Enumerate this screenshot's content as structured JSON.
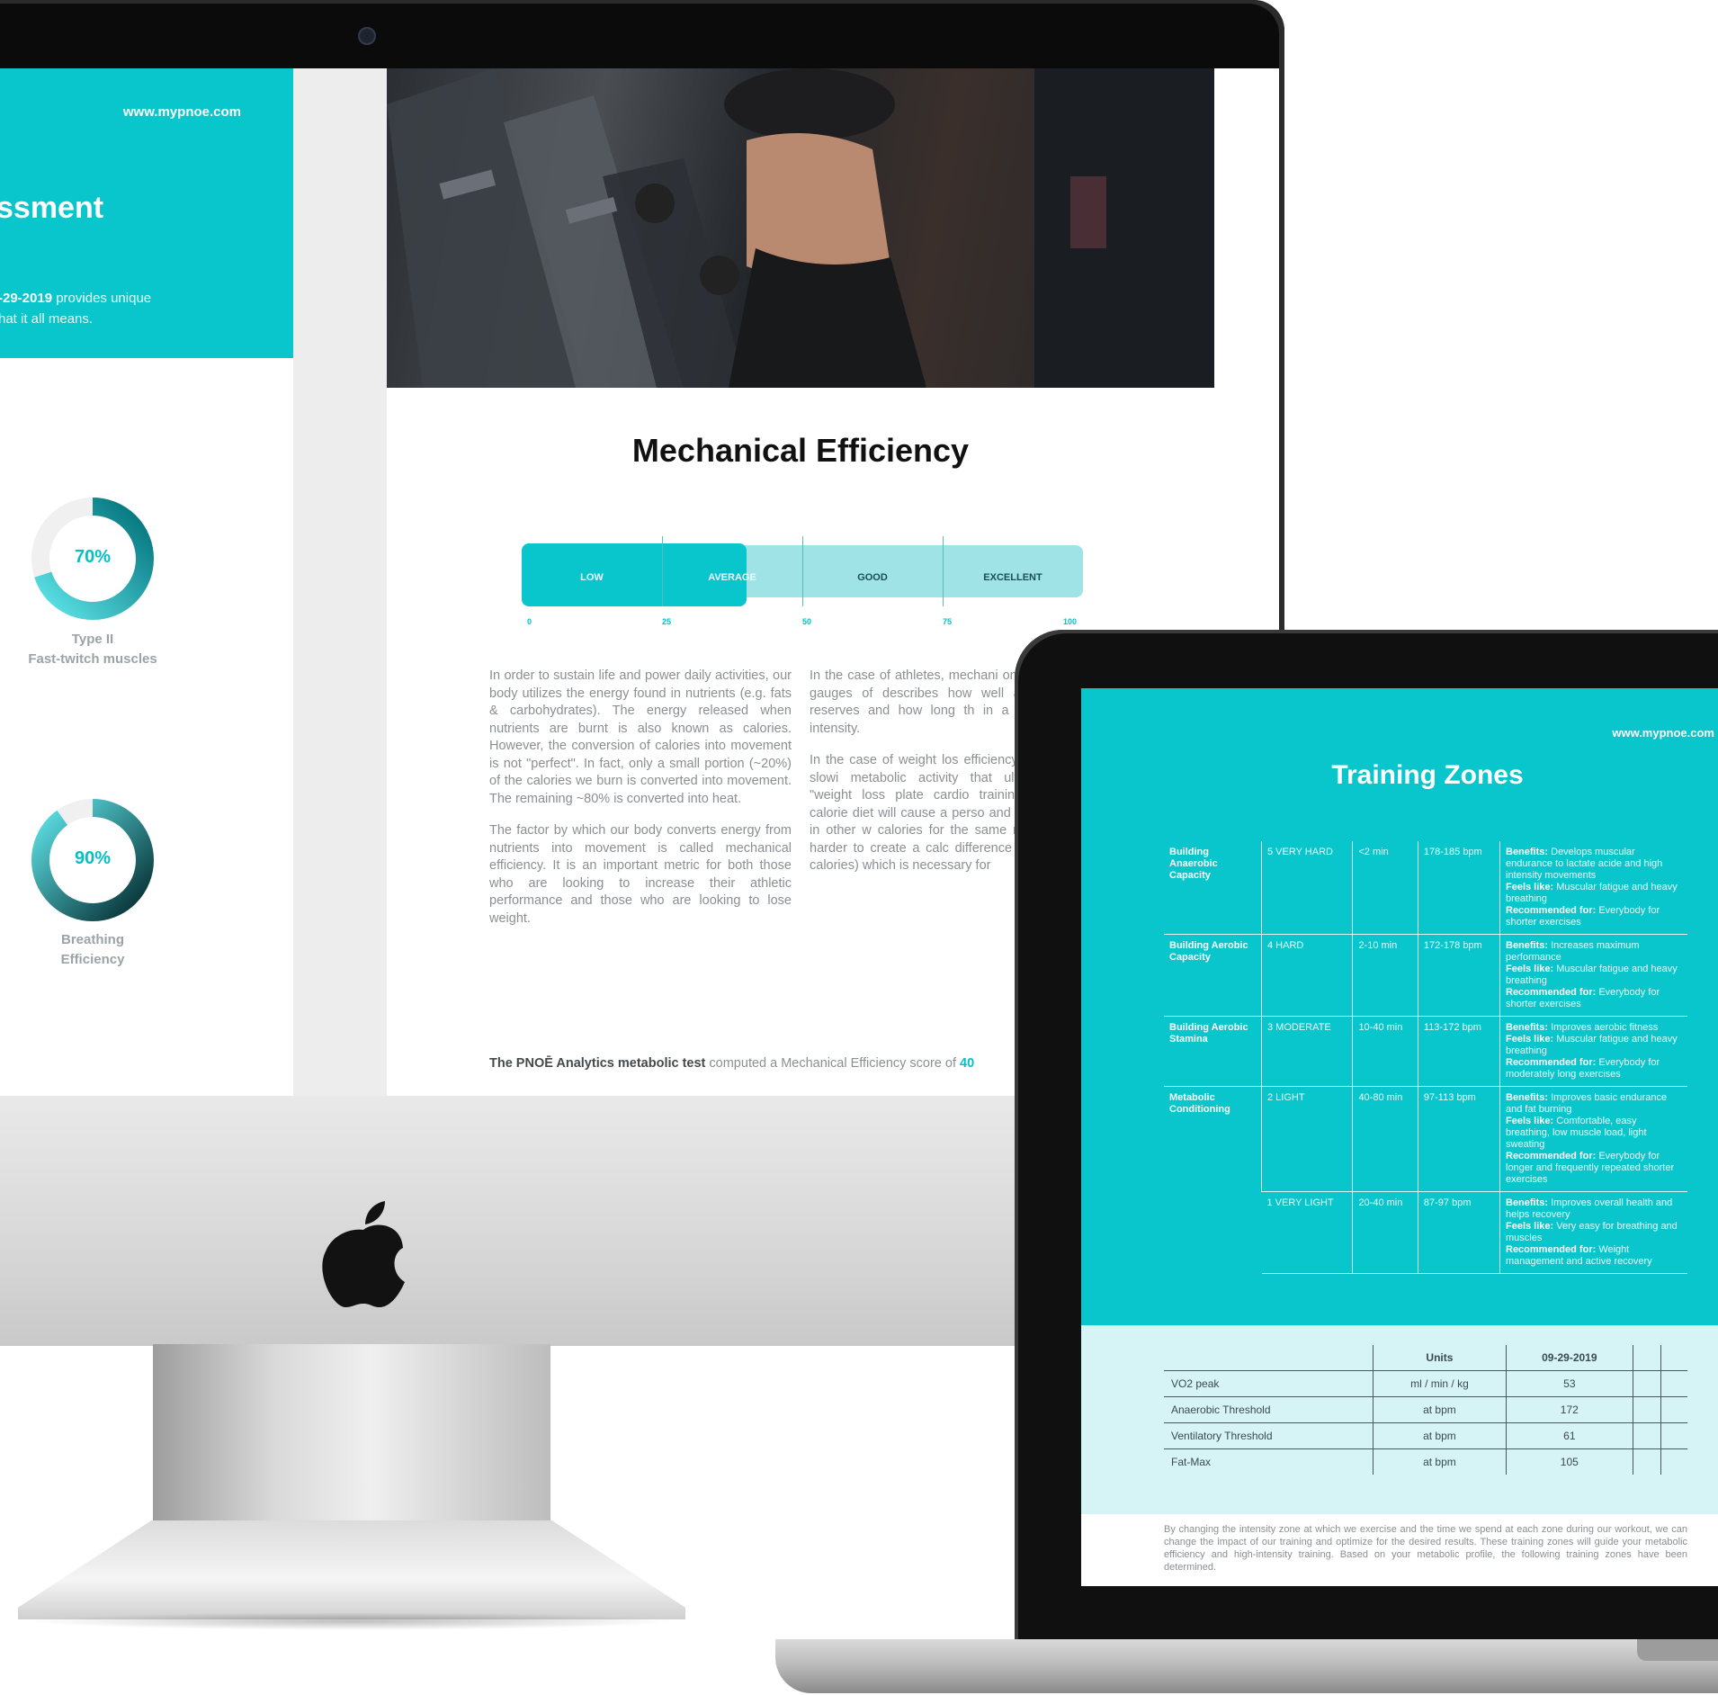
{
  "imac": {
    "left_page": {
      "url": "www.mypnoe.com",
      "title": "ssment",
      "desc_bold": "-29-2019",
      "desc_line1_rest": " provides unique",
      "desc_line2": "hat it all means.",
      "rings": [
        {
          "pct_label": "70%",
          "value": 70,
          "label": "Type II\nFast-twitch muscles"
        },
        {
          "pct_label": "90%",
          "value": 90,
          "label": "Breathing\nEfficiency"
        }
      ]
    },
    "main_page": {
      "title": "Mechanical Efficiency",
      "scale": {
        "segments": [
          "LOW",
          "AVERAGE",
          "GOOD",
          "EXCELLENT"
        ],
        "ticks": [
          "0",
          "25",
          "50",
          "75",
          "100"
        ],
        "fill_percent": 40
      },
      "col1": [
        "In order to sustain life and power daily activities, our body utilizes the energy found in nutrients (e.g. fats & carbohydrates). The energy released when nutrients are burnt is also known as calories. However, the conversion of calories into movement is not \"perfect\". In fact, only a small portion (~20%) of the calories we burn is converted into movement. The remaining ~80% is converted into heat.",
        "The factor by which our body converts energy from nutrients into movement is called mechanical efficiency. It is an important metric for both those who are looking to increase their athletic performance and those who are looking to lose weight."
      ],
      "col2": [
        "In the case of athletes, mechani one of the principal gauges of describes how well an athle energy reserves and how long th in a specific level of intensity.",
        "In the case of weight los efficiency can help detect slowi metabolic activity that ultimate notorious \"weight loss plate cardio training in combinatio calorie diet will cause a perso and conserve energy, in other w calories for the same movemen will be harder to create a calc difference between ingeste calories) which is necessary for"
      ],
      "summary_bold": "The PNOĒ Analytics metabolic test",
      "summary_text": " computed a Mechanical Efficiency score of ",
      "summary_value": "40"
    }
  },
  "macbook": {
    "url": "www.mypnoe.com",
    "title": "Training Zones",
    "zones": [
      {
        "name": "Building Anaerobic Capacity",
        "level": "5 VERY HARD",
        "time": "<2 min",
        "bpm": "178-185 bpm",
        "benefits": "Develops muscular endurance to lactate acide and high intensity movements",
        "feels": "Muscular fatigue and heavy breathing",
        "rec": "Everybody for shorter exercises"
      },
      {
        "name": "Building Aerobic Capacity",
        "level": "4 HARD",
        "time": "2-10 min",
        "bpm": "172-178 bpm",
        "benefits": "Increases maximum performance",
        "feels": "Muscular fatigue and heavy breathing",
        "rec": "Everybody for shorter exercises"
      },
      {
        "name": "Building Aerobic Stamina",
        "level": "3 MODERATE",
        "time": "10-40 min",
        "bpm": "113-172 bpm",
        "benefits": "Improves aerobic fitness",
        "feels": "Muscular fatigue and heavy breathing",
        "rec": "Everybody for moderately long exercises"
      },
      {
        "name": "Metabolic Conditioning",
        "level": "2 LIGHT",
        "time": "40-80 min",
        "bpm": "97-113 bpm",
        "benefits": "Improves basic endurance and fat burning",
        "feels": "Comfortable, easy breathing, low muscle load, light sweating",
        "rec": "Everybody for longer and frequently repeated shorter exercises"
      },
      {
        "name": "",
        "level": "1 VERY LIGHT",
        "time": "20-40 min",
        "bpm": "87-97 bpm",
        "benefits": "Improves overall health and helps recovery",
        "feels": "Very easy for breathing and muscles",
        "rec": "Weight management and active recovery"
      }
    ],
    "labels": {
      "benefits": "Benefits:",
      "feels": "Feels like:",
      "rec": "Recommended for:"
    },
    "metrics": {
      "headers": [
        "",
        "Units",
        "09-29-2019",
        "",
        ""
      ],
      "rows": [
        {
          "name": "VO2 peak",
          "unit": "ml / min / kg",
          "value": "53"
        },
        {
          "name": "Anaerobic Threshold",
          "unit": "at bpm",
          "value": "172"
        },
        {
          "name": "Ventilatory Threshold",
          "unit": "at bpm",
          "value": "61"
        },
        {
          "name": "Fat-Max",
          "unit": "at bpm",
          "value": "105"
        }
      ]
    },
    "footer": "By changing the intensity zone at which we exercise and the time we spend at each zone during our workout, we can change the impact of our training and optimize for the desired results. These training zones will guide your metabolic efficiency and high-intensity training. Based on your metabolic profile, the following training zones have been determined."
  },
  "colors": {
    "accent": "#08c6cc",
    "accent_light": "#9fe3e6",
    "pale": "#d6f4f5"
  }
}
